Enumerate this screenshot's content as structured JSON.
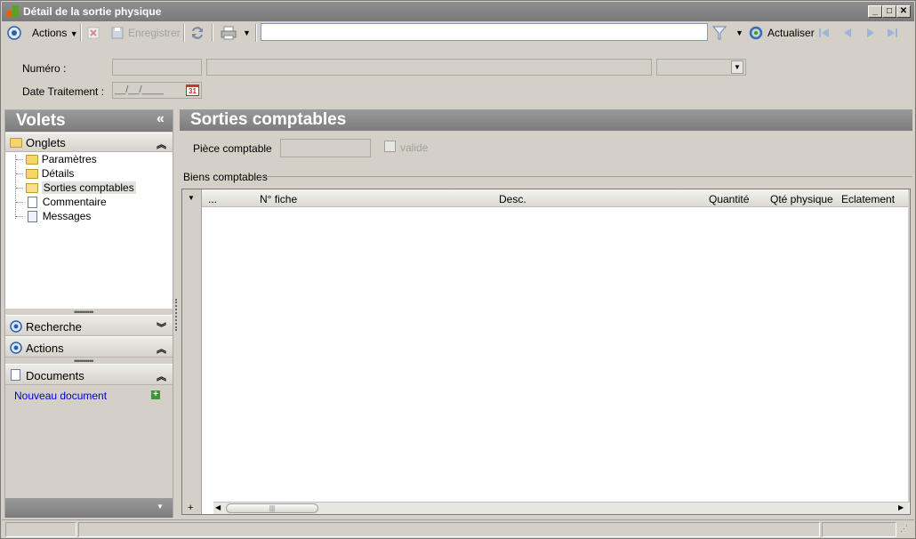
{
  "window": {
    "title": "Détail de la sortie physique",
    "min_label": "_",
    "max_label": "□",
    "close_label": "✕"
  },
  "toolbar": {
    "actions_label": "Actions",
    "save_label": "Enregistrer",
    "search_value": "",
    "refresh_label": "Actualiser"
  },
  "form": {
    "numero_label": "Numéro :",
    "date_label": "Date Traitement :",
    "date_placeholder": "__/__/____",
    "calendar_day": "31"
  },
  "volets": {
    "title": "Volets",
    "collapse_glyph": "«",
    "onglets_label": "Onglets",
    "tree": [
      "Paramètres",
      "Détails",
      "Sorties comptables",
      "Commentaire",
      "Messages"
    ],
    "selected_tree_item": "Sorties comptables",
    "recherche_label": "Recherche",
    "actions_label": "Actions",
    "documents_label": "Documents",
    "new_document_label": "Nouveau document"
  },
  "main": {
    "title": "Sorties comptables",
    "piece_label": "Pièce comptable",
    "valide_label": "valide",
    "valide_checked": false,
    "biens_label": "Biens comptables",
    "columns": [
      "...",
      "N° fiche",
      "Desc.",
      "Quantité",
      "Qté physique",
      "Eclatement"
    ],
    "rows": []
  },
  "colors": {
    "header_gray": "#7c7c7c",
    "link_blue": "#0000cc",
    "window_bg": "#d4d0c8"
  }
}
